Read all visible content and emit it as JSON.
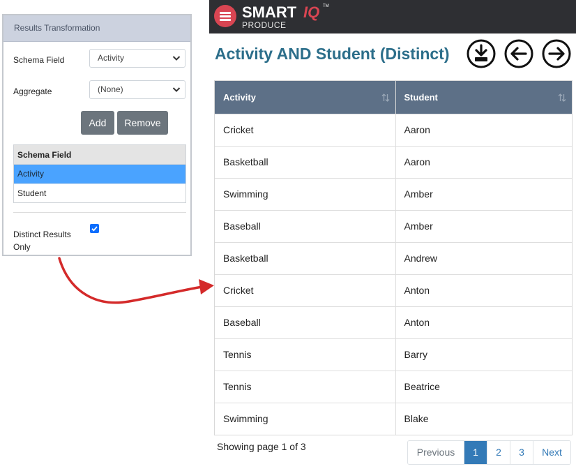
{
  "panel": {
    "title": "Results Transformation",
    "schema_field_label": "Schema Field",
    "schema_field_value": "Activity",
    "aggregate_label": "Aggregate",
    "aggregate_value": "(None)",
    "add_label": "Add",
    "remove_label": "Remove",
    "table_header": "Schema Field",
    "fields": [
      {
        "name": "Activity",
        "selected": true
      },
      {
        "name": "Student",
        "selected": false
      }
    ],
    "distinct_label": "Distinct Results Only",
    "distinct_checked": true
  },
  "brand": {
    "main": "SMART",
    "accent": "IQ",
    "tm": "TM",
    "sub": "PRODUCE"
  },
  "page_title": "Activity AND Student (Distinct)",
  "results": {
    "columns": [
      "Activity",
      "Student"
    ],
    "rows": [
      [
        "Cricket",
        "Aaron"
      ],
      [
        "Basketball",
        "Aaron"
      ],
      [
        "Swimming",
        "Amber"
      ],
      [
        "Baseball",
        "Amber"
      ],
      [
        "Basketball",
        "Andrew"
      ],
      [
        "Cricket",
        "Anton"
      ],
      [
        "Baseball",
        "Anton"
      ],
      [
        "Tennis",
        "Barry"
      ],
      [
        "Tennis",
        "Beatrice"
      ],
      [
        "Swimming",
        "Blake"
      ]
    ]
  },
  "pagination": {
    "status": "Showing page 1 of 3",
    "previous": "Previous",
    "pages": [
      "1",
      "2",
      "3"
    ],
    "active_page": "1",
    "next": "Next"
  },
  "colors": {
    "header_blue": "#5d7087",
    "title_teal": "#2c6e8a",
    "brand_red": "#d84552",
    "selected_row": "#4aa3ff",
    "arrow_red": "#d42a2a"
  },
  "icons": [
    "download-icon",
    "arrow-left-circle-icon",
    "arrow-right-circle-icon",
    "sort-icon",
    "chevron-down-icon",
    "menu-icon"
  ]
}
